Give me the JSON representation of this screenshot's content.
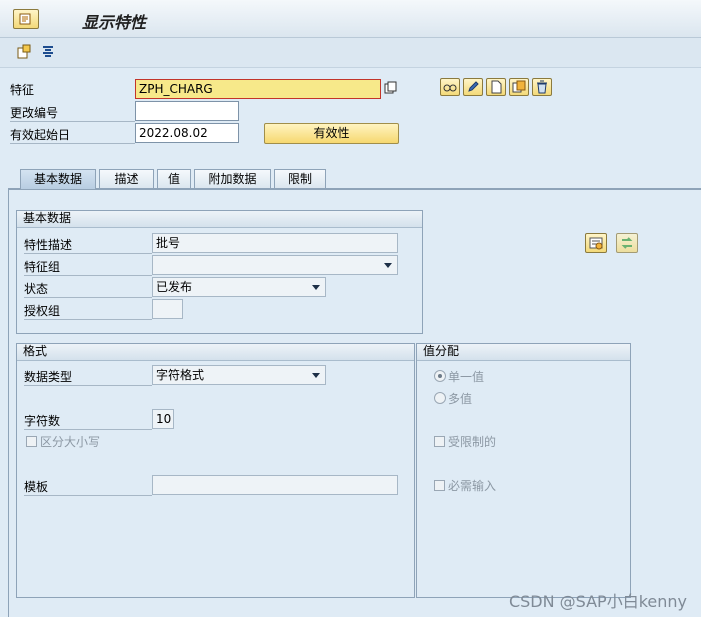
{
  "window": {
    "title": "显示特性"
  },
  "header": {
    "characteristic_label": "特征",
    "characteristic_value": "ZPH_CHARG",
    "change_number_label": "更改编号",
    "change_number_value": "",
    "valid_from_label": "有效起始日",
    "valid_from_value": "2022.08.02",
    "validity_button": "有效性"
  },
  "tabs": [
    {
      "label": "基本数据",
      "active": true
    },
    {
      "label": "描述"
    },
    {
      "label": "值"
    },
    {
      "label": "附加数据"
    },
    {
      "label": "限制"
    }
  ],
  "basic_data": {
    "group_title": "基本数据",
    "description_label": "特性描述",
    "description_value": "批号",
    "char_group_label": "特征组",
    "char_group_value": "",
    "status_label": "状态",
    "status_value": "已发布",
    "auth_group_label": "授权组",
    "auth_group_value": ""
  },
  "format": {
    "group_title": "格式",
    "data_type_label": "数据类型",
    "data_type_value": "字符格式",
    "num_chars_label": "字符数",
    "num_chars_value": "10",
    "case_sensitive_label": "区分大小写",
    "template_label": "模板",
    "template_value": ""
  },
  "value_assignment": {
    "group_title": "值分配",
    "single_value_label": "单一值",
    "multiple_values_label": "多值",
    "restricted_label": "受限制的",
    "required_entry_label": "必需输入"
  },
  "watermark": "CSDN @SAP小白kenny",
  "colors": {
    "accent_yellow": "#f6d870",
    "background": "#dfebf5",
    "tab_active": "#b8cde2"
  }
}
